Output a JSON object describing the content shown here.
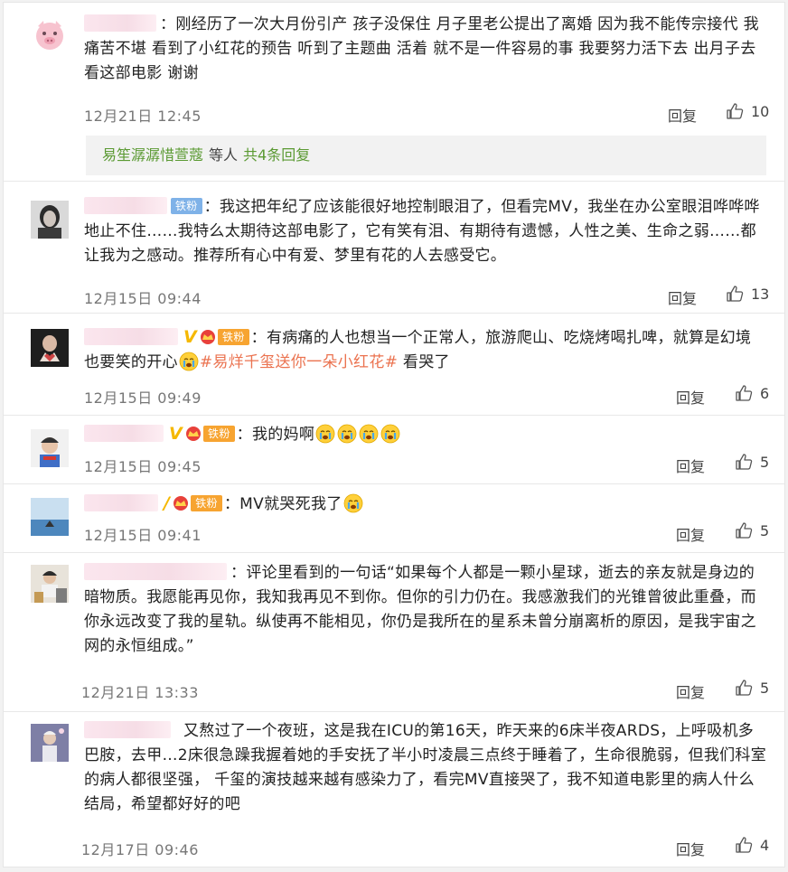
{
  "comments": [
    {
      "text": "刚经历了一次大月份引产 孩子没保住 月子里老公提出了离婚 因为我不能传宗接代 我痛苦不堪 看到了小红花的预告 听到了主题曲 活着 就不是一件容易的事 我要努力活下去 出月子去看这部电影 谢谢",
      "time": "12月21日 12:45",
      "reply": "回复",
      "likes": "10",
      "subreplies": {
        "names": "易笙潺潺惜萱蔻",
        "and": "等人",
        "count": "共4条回复"
      }
    },
    {
      "badge": "铁粉",
      "text": "我这把年纪了应该能很好地控制眼泪了，但看完MV，我坐在办公室眼泪哗哗哗地止不住……我特么太期待这部电影了，它有笑有泪、有期待有遗憾，人性之美、生命之弱……都让我为之感动。推荐所有心中有爱、梦里有花的人去感受它。",
      "time": "12月15日 09:44",
      "reply": "回复",
      "likes": "13"
    },
    {
      "vbadge": "V",
      "badge": "铁粉",
      "text_a": "有病痛的人也想当一个正常人，旅游爬山、吃烧烤喝扎啤，就算是幻境也要笑的开心",
      "topic": "#易烊千玺送你一朵小红花#",
      "text_b": " 看哭了",
      "time": "12月15日 09:49",
      "reply": "回复",
      "likes": "6"
    },
    {
      "vbadge": "V",
      "badge": "铁粉",
      "text": "我的妈啊",
      "emoji_count": 4,
      "time": "12月15日 09:45",
      "reply": "回复",
      "likes": "5"
    },
    {
      "vbadge": "/",
      "badge": "铁粉",
      "text": "MV就哭死我了",
      "time": "12月15日 09:41",
      "reply": "回复",
      "likes": "5"
    },
    {
      "text": "评论里看到的一句话“如果每个人都是一颗小星球，逝去的亲友就是身边的暗物质。我愿能再见你，我知我再见不到你。但你的引力仍在。我感激我们的光锥曾彼此重叠，而你永远改变了我的星轨。纵使再不能相见，你仍是我所在的星系未曾分崩离析的原因，是我宇宙之网的永恒组成。”",
      "time": "12月21日 13:33",
      "reply": "回复",
      "likes": "5"
    },
    {
      "text": "又熬过了一个夜班，这是我在ICU的第16天，昨天来的6床半夜ARDS，上呼吸机多巴胺，去甲…2床很急躁我握着她的手安抚了半小时凌晨三点终于睡着了，生命很脆弱，但我们科室的病人都很坚强， 千玺的演技越来越有感染力了，看完MV直接哭了，我不知道电影里的病人什么结局，希望都好好的吧",
      "time": "12月17日 09:46",
      "reply": "回复",
      "likes": "4"
    }
  ],
  "colors": {
    "topic": "#eb7350",
    "subreply_link": "#5b9a33",
    "fan_badge": "#f7a431",
    "vip": "#f5b800"
  }
}
